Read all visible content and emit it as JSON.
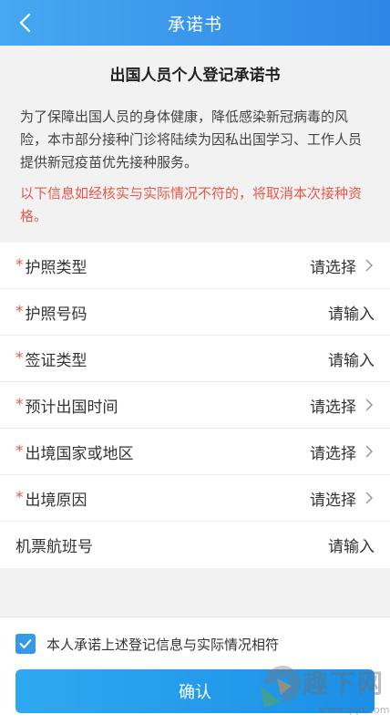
{
  "header": {
    "title": "承诺书"
  },
  "intro": {
    "doc_title": "出国人员个人登记承诺书",
    "description": "为了保障出国人员的身体健康，降低感染新冠病毒的风险，本市部分接种门诊将陆续为因私出国学习、工作人员提供新冠疫苗优先接种服务。",
    "warning": "以下信息如经核实与实际情况不符的，将取消本次接种资格。"
  },
  "form": {
    "rows": [
      {
        "label": "护照类型",
        "required": true,
        "value": "请选择",
        "has_chevron": true
      },
      {
        "label": "护照号码",
        "required": true,
        "value": "请输入",
        "has_chevron": false
      },
      {
        "label": "签证类型",
        "required": true,
        "value": "请输入",
        "has_chevron": false
      },
      {
        "label": "预计出国时间",
        "required": true,
        "value": "请选择",
        "has_chevron": true
      },
      {
        "label": "出境国家或地区",
        "required": true,
        "value": "请选择",
        "has_chevron": true
      },
      {
        "label": "出境原因",
        "required": true,
        "value": "请选择",
        "has_chevron": true
      },
      {
        "label": "机票航班号",
        "required": false,
        "value": "请输入",
        "has_chevron": false
      }
    ],
    "required_mark": "*"
  },
  "footer": {
    "agree_checked": true,
    "agree_text": "本人承诺上述登记信息与实际情况相符",
    "confirm_label": "确认"
  },
  "watermark": {
    "text": "趣下网",
    "url": "www.qqd.com"
  },
  "colors": {
    "header": "#2e86e6",
    "warning": "#e8584b",
    "button": "#1b8fe6",
    "checkbox": "#3598e8"
  }
}
